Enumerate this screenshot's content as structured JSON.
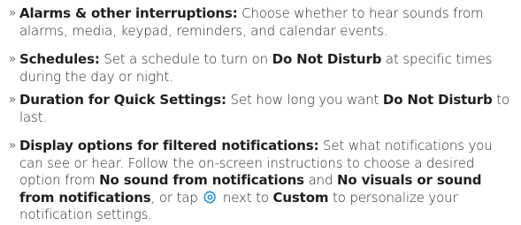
{
  "bullets": {
    "glyph": "»"
  },
  "items": [
    {
      "title": "Alarms & other interruptions:",
      "text1": " Choose whether to hear sounds from alarms, media, keypad, reminders, and calendar events."
    },
    {
      "title": "Schedules:",
      "text1": " Set a schedule to turn on ",
      "bold1": "Do Not Disturb",
      "text2": " at specific times during the day or night."
    },
    {
      "title": "Duration for Quick Settings:",
      "text1": " Set how long you want ",
      "bold1": "Do Not Disturb",
      "text2": " to last."
    },
    {
      "title": "Display options for filtered notifications:",
      "text1": " Set what notifications you can see or hear. Follow the on-screen instructions to choose a desired option from ",
      "bold1": "No sound from notifications",
      "text2": " and ",
      "bold2": "No visuals or sound from notifications",
      "text3": ", or tap ",
      "icon": "settings-gear-icon",
      "text4": " next to ",
      "bold3": "Custom",
      "text5": " to personalize your notification settings."
    }
  ],
  "colors": {
    "text": "#2b2b2b",
    "icon": "#2a8fd8"
  }
}
